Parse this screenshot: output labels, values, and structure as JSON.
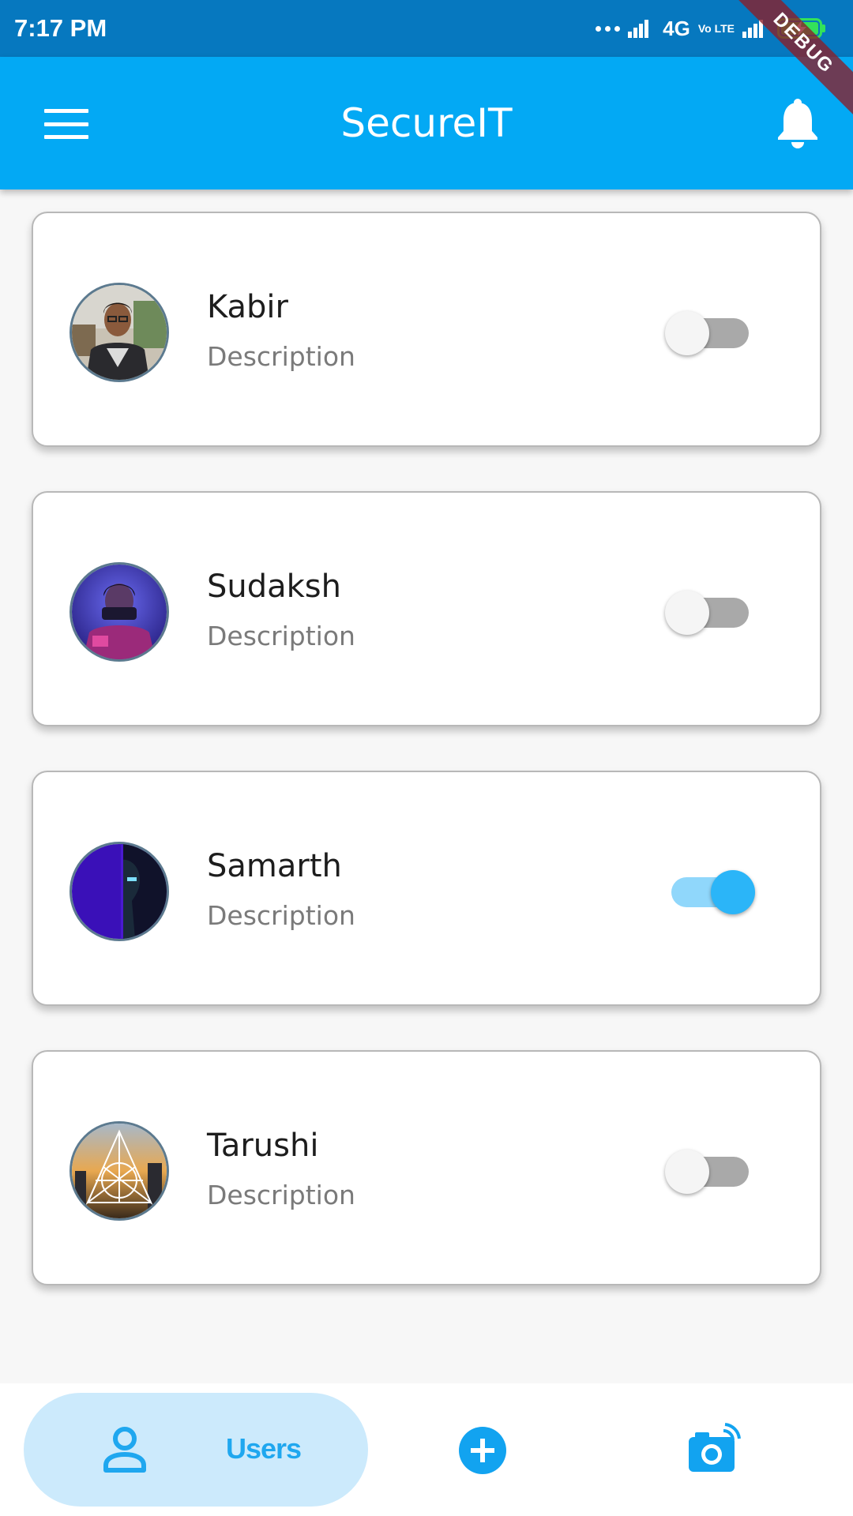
{
  "status_bar": {
    "time": "7:17 PM",
    "network": "4G",
    "volte": "Vo LTE"
  },
  "debug_banner": "DEBUG",
  "app_bar": {
    "title": "SecureIT"
  },
  "users": [
    {
      "name": "Kabir",
      "description": "Description",
      "enabled": false
    },
    {
      "name": "Sudaksh",
      "description": "Description",
      "enabled": false
    },
    {
      "name": "Samarth",
      "description": "Description",
      "enabled": true
    },
    {
      "name": "Tarushi",
      "description": "Description",
      "enabled": false
    }
  ],
  "bottom_nav": {
    "users_label": "Users",
    "active": "users"
  },
  "colors": {
    "status_bar": "#0678bf",
    "app_bar": "#03a9f4",
    "accent": "#2bb5f8",
    "nav_active_bg": "#cceafc"
  },
  "icons": [
    "menu-icon",
    "bell-icon",
    "person-icon",
    "add-circle-icon",
    "camera-icon"
  ]
}
